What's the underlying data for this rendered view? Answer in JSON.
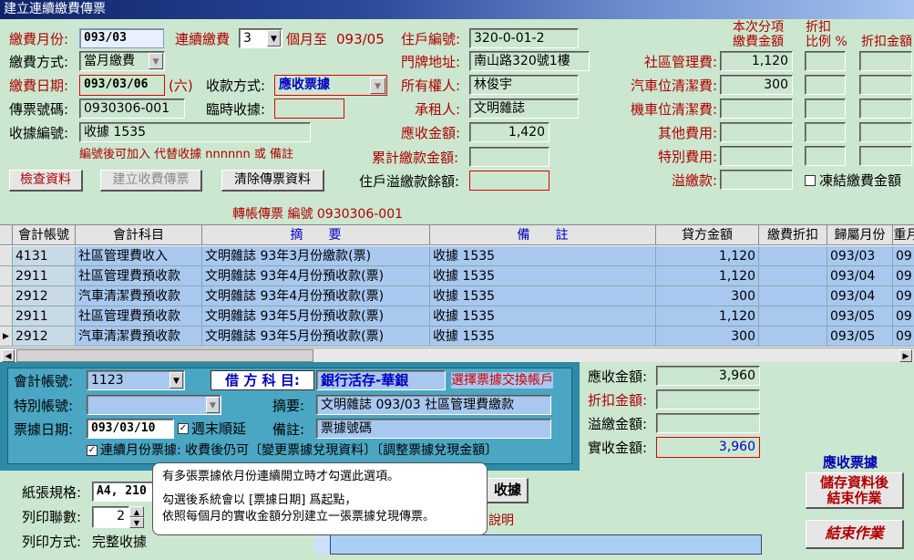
{
  "window": {
    "title": "建立連續繳費傳票"
  },
  "header": {
    "billing_month_label": "繳費月份:",
    "billing_month": "093/03",
    "continuous_label": "連續繳費",
    "continuous_count": "3",
    "month_to_label": "個月至",
    "month_to": "093/05",
    "pay_method_label": "繳費方式:",
    "pay_method": "當月繳費",
    "pay_date_label": "繳費日期:",
    "pay_date": "093/03/06",
    "weekday": "(六)",
    "collect_method_label": "收款方式:",
    "collect_method": "應收票據",
    "voucher_no_label": "傳票號碼:",
    "voucher_no": "0930306-001",
    "temp_receipt_label": "臨時收據:",
    "temp_receipt": "",
    "receipt_no_label": "收據編號:",
    "receipt_no": "收據 1535",
    "receipt_note": "編號後可加入 代替收據 nnnnnn 或 備註",
    "household_no_label": "住戶編號:",
    "household_no": "320-0-01-2",
    "address_label": "門牌地址:",
    "address": "南山路320號1樓",
    "owner_label": "所有權人:",
    "owner": "林俊宇",
    "tenant_label": "承租人:",
    "tenant": "文明雜誌",
    "receivable_label": "應收金額:",
    "receivable": "1,420",
    "cumulative_label": "累計繳款金額:",
    "cumulative": "",
    "overpay_balance_label": "住戶溢繳款餘額:",
    "overpay_balance": ""
  },
  "fees": {
    "col_amount_title": "本次分項\n繳費金額",
    "col_amount_line1": "本次分項",
    "col_amount_line2": "繳費金額",
    "col_ratio_line1": "折扣",
    "col_ratio_line2": "比例 %",
    "col_discount": "折扣金額",
    "items": [
      {
        "label": "社區管理費:",
        "amount": "1,120"
      },
      {
        "label": "汽車位清潔費:",
        "amount": "300"
      },
      {
        "label": "機車位清潔費:",
        "amount": ""
      },
      {
        "label": "其他費用:",
        "amount": ""
      },
      {
        "label": "特別費用:",
        "amount": ""
      },
      {
        "label": "溢繳款:",
        "amount": ""
      }
    ],
    "freeze_label": "凍結繳費金額"
  },
  "buttons": {
    "check": "檢查資料",
    "create": "建立收費傳票",
    "clear": "清除傳票資料",
    "save_line1": "儲存資料後",
    "save_line2": "結束作業",
    "exit": "結束作業",
    "receipt_partial": "收據"
  },
  "transfer_title": "轉帳傳票 編號 0930306-001",
  "grid": {
    "columns": [
      "會計帳號",
      "會計科目",
      "摘　　要",
      "備　　註",
      "貸方金額",
      "繳費折扣",
      "歸屬月份",
      "重月"
    ],
    "rows": [
      {
        "acct": "4131",
        "subject": "社區管理費收入",
        "summary": "文明雜誌 93年3月份繳款(票)",
        "note": "收據 1535",
        "credit": "1,120",
        "discount": "",
        "month": "093/03",
        "extra": "09"
      },
      {
        "acct": "2911",
        "subject": "社區管理費預收款",
        "summary": "文明雜誌 93年4月份預收款(票)",
        "note": "收據 1535",
        "credit": "1,120",
        "discount": "",
        "month": "093/04",
        "extra": "09"
      },
      {
        "acct": "2912",
        "subject": "汽車清潔費預收款",
        "summary": "文明雜誌 93年4月份預收款(票)",
        "note": "收據 1535",
        "credit": "300",
        "discount": "",
        "month": "093/04",
        "extra": "09"
      },
      {
        "acct": "2911",
        "subject": "社區管理費預收款",
        "summary": "文明雜誌 93年5月份預收款(票)",
        "note": "收據 1535",
        "credit": "1,120",
        "discount": "",
        "month": "093/05",
        "extra": "09"
      },
      {
        "acct": "2912",
        "subject": "汽車清潔費預收款",
        "summary": "文明雜誌 93年5月份預收款(票)",
        "note": "收據 1535",
        "credit": "300",
        "discount": "",
        "month": "093/05",
        "extra": "09"
      }
    ]
  },
  "panel": {
    "acct_label": "會計帳號:",
    "acct": "1123",
    "debit_label": "借 方 科 目:",
    "debit": "銀行活存-華銀",
    "swap_link": "選擇票據交換帳戶",
    "special_label": "特別帳號:",
    "special": "",
    "summary_label": "摘要:",
    "summary": "文明雜誌 093/03 社區管理費繳款",
    "bill_date_label": "票據日期:",
    "bill_date": "093/03/10",
    "weekend_label": "週末順延",
    "memo_label": "備註:",
    "memo": "票據號碼",
    "monthly_label": "連續月份票據: 收費後仍可〔變更票據兌現資料〕〔調整票據兌現金額〕"
  },
  "totals": {
    "receivable_label": "應收金額:",
    "receivable": "3,960",
    "discount_label": "折扣金額:",
    "discount": "",
    "overpay_label": "溢繳金額:",
    "overpay": "",
    "actual_label": "實收金額:",
    "actual": "3,960",
    "mode": "應收票據"
  },
  "footer": {
    "paper_label": "紙張規格:",
    "paper": "A4, 210",
    "copies_label": "列印聯數:",
    "copies": "2",
    "print_mode_label": "列印方式:",
    "print_mode": "完整收據",
    "explain_partial": "說明"
  },
  "tooltip": {
    "line1": "有多張票據依月份連續開立時才勾選此選項。",
    "line2": "勾選後系統會以 [票據日期] 爲起點，",
    "line3": "依照每個月的實收金額分別建立一張票據兌現傳票。"
  }
}
